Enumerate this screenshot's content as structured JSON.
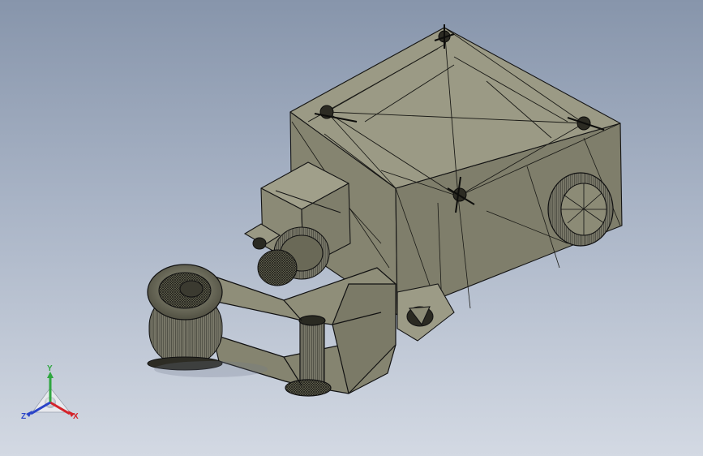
{
  "app": {
    "accent": "#ffffff",
    "background_top": "#8795ab",
    "background_bottom": "#d3d9e3"
  },
  "model": {
    "mesh_color": "#8d8c77",
    "edge_color": "#111111",
    "triad": {
      "x_label": "X",
      "y_label": "Y",
      "z_label": "Z",
      "x_color": "#d4232a",
      "y_color": "#2fa640",
      "z_color": "#2a44c8"
    }
  }
}
